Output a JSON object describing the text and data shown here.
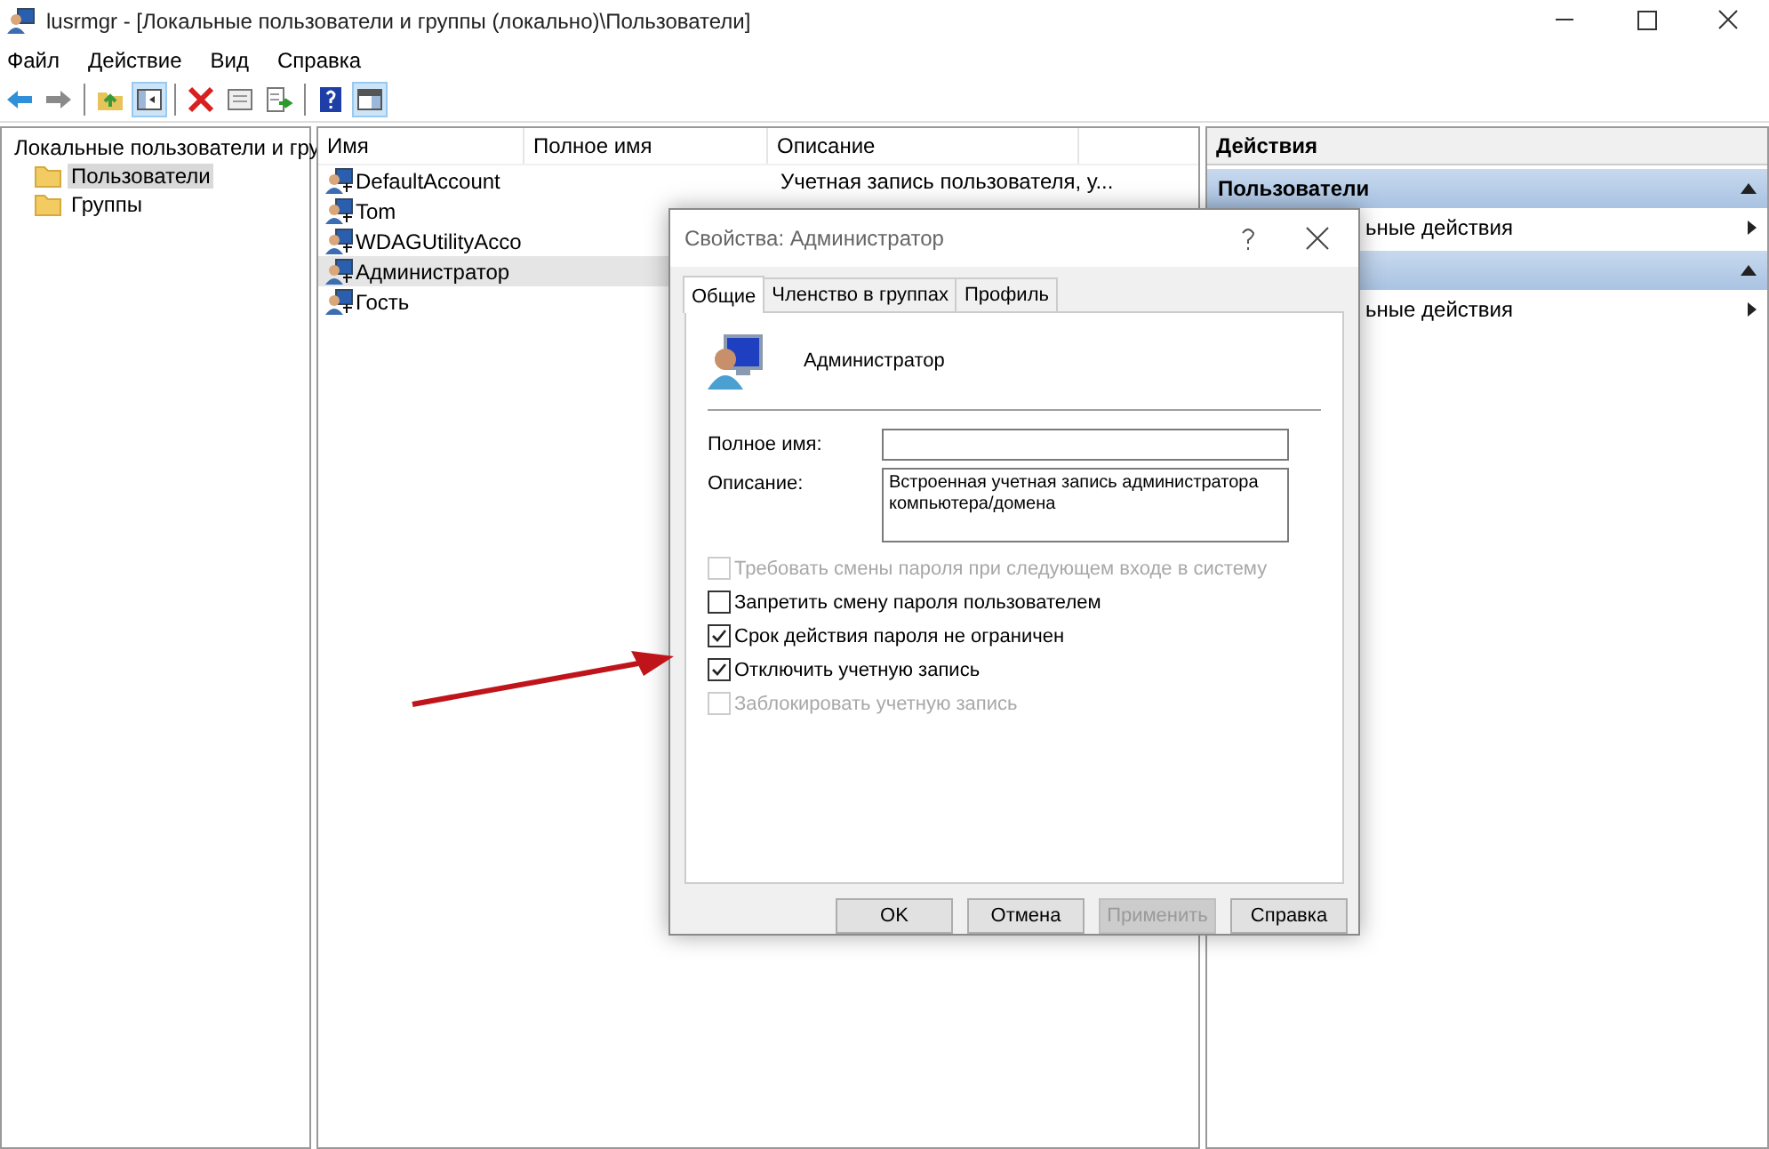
{
  "window": {
    "title": "lusrmgr - [Локальные пользователи и группы (локально)\\Пользователи]"
  },
  "menu": [
    "Файл",
    "Действие",
    "Вид",
    "Справка"
  ],
  "toolbar": [
    {
      "kind": "back",
      "pressed": false
    },
    {
      "kind": "forward",
      "pressed": false
    },
    {
      "kind": "sep"
    },
    {
      "kind": "up",
      "pressed": false
    },
    {
      "kind": "tree",
      "pressed": true
    },
    {
      "kind": "sep"
    },
    {
      "kind": "delete",
      "pressed": false
    },
    {
      "kind": "properties",
      "pressed": false
    },
    {
      "kind": "export",
      "pressed": false
    },
    {
      "kind": "sep"
    },
    {
      "kind": "help",
      "pressed": false
    },
    {
      "kind": "pane",
      "pressed": true
    }
  ],
  "tree": [
    {
      "label": "Локальные пользователи и гру",
      "selected": false,
      "children": [
        {
          "label": "Пользователи",
          "selected": true
        },
        {
          "label": "Группы",
          "selected": false
        }
      ]
    }
  ],
  "list": {
    "columns": [
      "Имя",
      "Полное имя",
      "Описание"
    ],
    "rows": [
      {
        "name": "DefaultAccount",
        "description": "Учетная запись пользователя, у...",
        "selected": false
      },
      {
        "name": "Tom",
        "selected": false
      },
      {
        "name": "WDAGUtilityAcco",
        "selected": false
      },
      {
        "name": "Администратор",
        "selected": true
      },
      {
        "name": "Гость",
        "selected": false
      }
    ]
  },
  "actions": {
    "title": "Действия",
    "sections": [
      {
        "header": "Пользователи",
        "expanded": true,
        "items": [
          "ьные действия"
        ]
      },
      {
        "expanded": true,
        "items": [
          "ьные действия"
        ]
      }
    ]
  },
  "dialog": {
    "title": "Свойства: Администратор",
    "tabs": [
      {
        "label": "Общие",
        "selected": true
      },
      {
        "label": "Членство в группах",
        "selected": false
      },
      {
        "label": "Профиль",
        "selected": false
      }
    ],
    "user": "Администратор",
    "fields": [
      {
        "label": "Полное имя:",
        "kind": "line"
      },
      {
        "label": "Описание:",
        "kind": "area",
        "value": "Встроенная учетная запись администратора компьютера/домена"
      }
    ],
    "options": [
      {
        "label": "Требовать смены пароля при следующем входе в систему",
        "checked": false,
        "disabled": true
      },
      {
        "label": "Запретить смену пароля пользователем",
        "checked": false,
        "disabled": false
      },
      {
        "label": "Срок действия пароля не ограничен",
        "checked": true,
        "disabled": false
      },
      {
        "label": "Отключить учетную запись",
        "checked": true,
        "disabled": false
      },
      {
        "label": "Заблокировать учетную запись",
        "checked": false,
        "disabled": true
      }
    ],
    "buttons": [
      {
        "label": "OK",
        "disabled": false
      },
      {
        "label": "Отмена",
        "disabled": false
      },
      {
        "label": "Применить",
        "disabled": true
      },
      {
        "label": "Справка",
        "disabled": false
      }
    ]
  },
  "annotations": [
    {
      "kind": "arrow"
    }
  ]
}
